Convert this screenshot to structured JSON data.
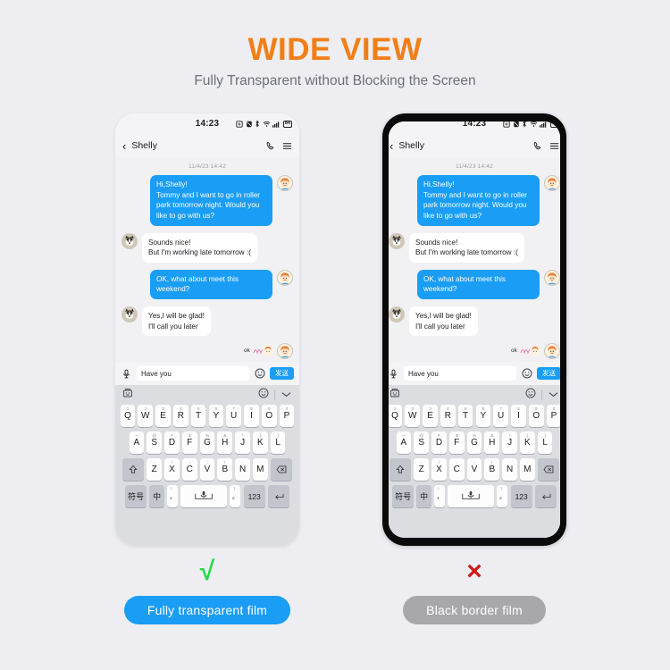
{
  "hero": {
    "title": "WIDE VIEW",
    "subtitle": "Fully Transparent without Blocking the Screen",
    "title_color": "#f07f19",
    "subtitle_color": "#6d7075",
    "background": "#eeeef2"
  },
  "phone": {
    "status_bar": {
      "time": "14:23",
      "battery": "84",
      "icons": [
        "alarm-icon",
        "mute-icon",
        "bluetooth-icon",
        "wifi-icon",
        "signal-icon",
        "battery-icon"
      ]
    },
    "chat_header": {
      "back": "‹",
      "contact": "Shelly",
      "call_icon": "phone-icon",
      "menu_icon": "menu-icon"
    },
    "chat": {
      "timestamp": "11/4/23 14:42",
      "messages": [
        {
          "side": "out",
          "text": "Hi,Shelly!\nTommy and I want to go in roller park tomorrow night. Would you like to go with us?"
        },
        {
          "side": "in",
          "text": "Sounds nice!\nBut I'm working late tomorrow :("
        },
        {
          "side": "out",
          "text": "OK, what about meet this weekend?"
        },
        {
          "side": "in",
          "text": "Yes,I will be glad!\nI'll call you later"
        }
      ],
      "sticker_label": "ok"
    },
    "input_bar": {
      "mic_icon": "microphone-icon",
      "text": "Have you",
      "placeholder": "Have you",
      "emoji_icon": "smiley-icon",
      "send_label": "发送"
    },
    "keyboard": {
      "toolbar": {
        "sticker_icon": "sticker-icon",
        "emoji_icon": "smiley-icon",
        "collapse_icon": "chevron-down-icon"
      },
      "row1": [
        {
          "key": "Q",
          "sup": "1"
        },
        {
          "key": "W",
          "sup": "2"
        },
        {
          "key": "E",
          "sup": "3"
        },
        {
          "key": "R",
          "sup": "4"
        },
        {
          "key": "T",
          "sup": "5"
        },
        {
          "key": "Y",
          "sup": "6"
        },
        {
          "key": "U",
          "sup": "7"
        },
        {
          "key": "I",
          "sup": "8"
        },
        {
          "key": "O",
          "sup": "9"
        },
        {
          "key": "P",
          "sup": "0"
        }
      ],
      "row2": [
        {
          "key": "A",
          "sup": "~"
        },
        {
          "key": "S",
          "sup": "@"
        },
        {
          "key": "D",
          "sup": "#"
        },
        {
          "key": "F",
          "sup": "$"
        },
        {
          "key": "G",
          "sup": "%"
        },
        {
          "key": "H",
          "sup": "&"
        },
        {
          "key": "J",
          "sup": "*"
        },
        {
          "key": "K",
          "sup": "("
        },
        {
          "key": "L",
          "sup": ")"
        }
      ],
      "row3": [
        {
          "key": "Z",
          "sup": "-"
        },
        {
          "key": "X",
          "sup": "/"
        },
        {
          "key": "C",
          "sup": ":"
        },
        {
          "key": "V",
          "sup": ";"
        },
        {
          "key": "B",
          "sup": "!"
        },
        {
          "key": "N",
          "sup": "·"
        },
        {
          "key": "M",
          "sup": "·"
        }
      ],
      "shift_icon": "shift-icon",
      "backspace_icon": "backspace-icon",
      "row4": {
        "symbols": "符号",
        "lang": "中",
        "lang_sub": "英",
        "comma_sup": "！",
        "comma": "，",
        "space_icon": "microphone-icon",
        "period_sup": "？",
        "period": "。",
        "numbers": "123",
        "enter_icon": "enter-icon"
      }
    }
  },
  "verdicts": {
    "left": {
      "mark": "√",
      "mark_color": "#25d94a",
      "label": "Fully transparent film",
      "pill_color": "#1a9df5"
    },
    "right": {
      "mark": "×",
      "mark_color": "#cc1b1b",
      "label": "Black border film",
      "pill_color": "#a8a8ab"
    }
  }
}
